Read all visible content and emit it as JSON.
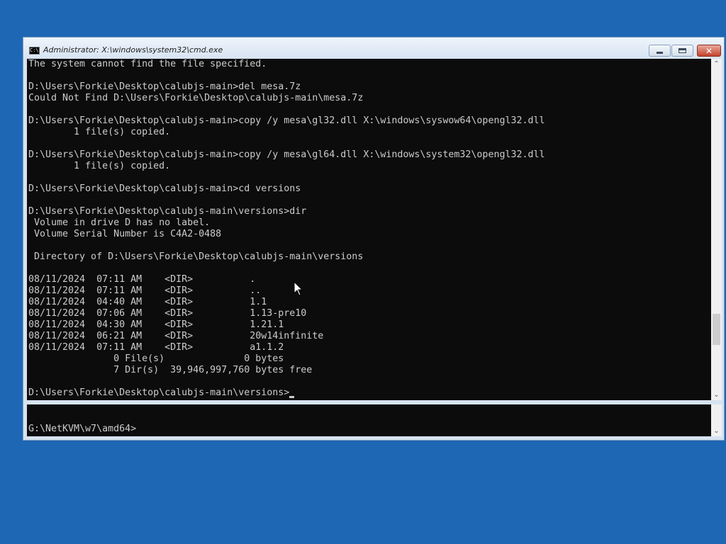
{
  "window": {
    "title": "Administrator: X:\\windows\\system32\\cmd.exe",
    "icon": "console-icon",
    "icon_text": "C:\\"
  },
  "controls": {
    "minimize": "minimize-icon",
    "maximize": "maximize-icon",
    "close": "close-icon",
    "close_glyph": "✕"
  },
  "console": {
    "output": "The system cannot find the file specified.\n\nD:\\Users\\Forkie\\Desktop\\calubjs-main>del mesa.7z\nCould Not Find D:\\Users\\Forkie\\Desktop\\calubjs-main\\mesa.7z\n\nD:\\Users\\Forkie\\Desktop\\calubjs-main>copy /y mesa\\gl32.dll X:\\windows\\syswow64\\opengl32.dll\n        1 file(s) copied.\n\nD:\\Users\\Forkie\\Desktop\\calubjs-main>copy /y mesa\\gl64.dll X:\\windows\\system32\\opengl32.dll\n        1 file(s) copied.\n\nD:\\Users\\Forkie\\Desktop\\calubjs-main>cd versions\n\nD:\\Users\\Forkie\\Desktop\\calubjs-main\\versions>dir\n Volume in drive D has no label.\n Volume Serial Number is C4A2-0488\n\n Directory of D:\\Users\\Forkie\\Desktop\\calubjs-main\\versions\n\n08/11/2024  07:11 AM    <DIR>          .\n08/11/2024  07:11 AM    <DIR>          ..\n08/11/2024  04:40 AM    <DIR>          1.1\n08/11/2024  07:06 AM    <DIR>          1.13-pre10\n08/11/2024  04:30 AM    <DIR>          1.21.1\n08/11/2024  06:21 AM    <DIR>          20w14infinite\n08/11/2024  07:11 AM    <DIR>          a1.1.2\n               0 File(s)              0 bytes\n               7 Dir(s)  39,946,997,760 bytes free\n\nD:\\Users\\Forkie\\Desktop\\calubjs-main\\versions>",
    "colors": {
      "background": "#0c0c0c",
      "foreground": "#cccccc"
    }
  },
  "console2": {
    "prompt": "G:\\NetKVM\\w7\\amd64>"
  },
  "scrollbar": {
    "up_arrow": "⌃",
    "down_arrow": "⌄"
  },
  "desktop": {
    "background": "#1e67b5"
  }
}
